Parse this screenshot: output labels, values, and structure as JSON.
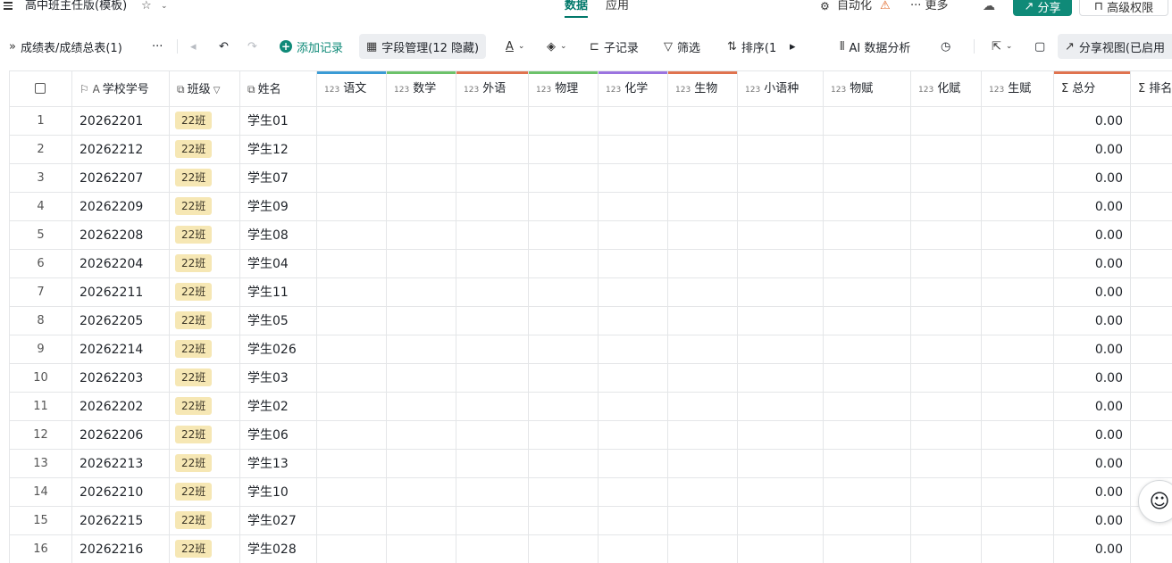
{
  "app": {
    "title": "高中班主任版(模板)",
    "tabs": {
      "data": "数据",
      "app": "应用"
    },
    "automation": "自动化",
    "more": "更多",
    "share": "分享",
    "permissions": "高级权限"
  },
  "toolbar": {
    "breadcrumb": "成绩表/成绩总表(1)",
    "more": "···",
    "add_record": "添加记录",
    "field_manage": "字段管理(12 隐藏)",
    "sub_record": "子记录",
    "filter": "筛选",
    "sort": "排序(1",
    "ai_analysis": "AI 数据分析",
    "share_view": "分享视图(已启用"
  },
  "columns": [
    {
      "key": "id",
      "label": "学校学号",
      "icon": "flag-text-icon"
    },
    {
      "key": "class",
      "label": "班级",
      "icon": "link-icon"
    },
    {
      "key": "name",
      "label": "姓名",
      "icon": "link-icon"
    },
    {
      "key": "chinese",
      "label": "语文",
      "type": "123",
      "color": "#3a9bd5"
    },
    {
      "key": "math",
      "label": "数学",
      "type": "123",
      "color": "#6cc26a"
    },
    {
      "key": "english",
      "label": "外语",
      "type": "123",
      "color": "#e0734f"
    },
    {
      "key": "physics",
      "label": "物理",
      "type": "123",
      "color": "#6cc26a"
    },
    {
      "key": "chemistry",
      "label": "化学",
      "type": "123",
      "color": "#9b73e0"
    },
    {
      "key": "biology",
      "label": "生物",
      "type": "123",
      "color": "#e0734f"
    },
    {
      "key": "minor_lang",
      "label": "小语种",
      "type": "123",
      "color": ""
    },
    {
      "key": "phys_score",
      "label": "物赋",
      "type": "123",
      "color": ""
    },
    {
      "key": "chem_score",
      "label": "化赋",
      "type": "123",
      "color": ""
    },
    {
      "key": "bio_score",
      "label": "生赋",
      "type": "123",
      "color": ""
    },
    {
      "key": "total",
      "label": "总分",
      "type": "Σ",
      "color": "#e0734f"
    },
    {
      "key": "rank",
      "label": "排名",
      "type": "Σ",
      "color": ""
    }
  ],
  "rows": [
    {
      "n": "1",
      "id": "20262201",
      "class": "22班",
      "name": "学生01",
      "total": "0.00"
    },
    {
      "n": "2",
      "id": "20262212",
      "class": "22班",
      "name": "学生12",
      "total": "0.00"
    },
    {
      "n": "3",
      "id": "20262207",
      "class": "22班",
      "name": "学生07",
      "total": "0.00"
    },
    {
      "n": "4",
      "id": "20262209",
      "class": "22班",
      "name": "学生09",
      "total": "0.00"
    },
    {
      "n": "5",
      "id": "20262208",
      "class": "22班",
      "name": "学生08",
      "total": "0.00"
    },
    {
      "n": "6",
      "id": "20262204",
      "class": "22班",
      "name": "学生04",
      "total": "0.00"
    },
    {
      "n": "7",
      "id": "20262211",
      "class": "22班",
      "name": "学生11",
      "total": "0.00"
    },
    {
      "n": "8",
      "id": "20262205",
      "class": "22班",
      "name": "学生05",
      "total": "0.00"
    },
    {
      "n": "9",
      "id": "20262214",
      "class": "22班",
      "name": "学生026",
      "total": "0.00"
    },
    {
      "n": "10",
      "id": "20262203",
      "class": "22班",
      "name": "学生03",
      "total": "0.00"
    },
    {
      "n": "11",
      "id": "20262202",
      "class": "22班",
      "name": "学生02",
      "total": "0.00"
    },
    {
      "n": "12",
      "id": "20262206",
      "class": "22班",
      "name": "学生06",
      "total": "0.00"
    },
    {
      "n": "13",
      "id": "20262213",
      "class": "22班",
      "name": "学生13",
      "total": "0.00"
    },
    {
      "n": "14",
      "id": "20262210",
      "class": "22班",
      "name": "学生10",
      "total": "0.00"
    },
    {
      "n": "15",
      "id": "20262215",
      "class": "22班",
      "name": "学生027",
      "total": "0.00"
    },
    {
      "n": "16",
      "id": "20262216",
      "class": "22班",
      "name": "学生028",
      "total": "0.00"
    }
  ],
  "colors": {
    "brand": "#0f8a78",
    "tag_bg": "#f6e7b4",
    "warning": "#e06a2b"
  }
}
